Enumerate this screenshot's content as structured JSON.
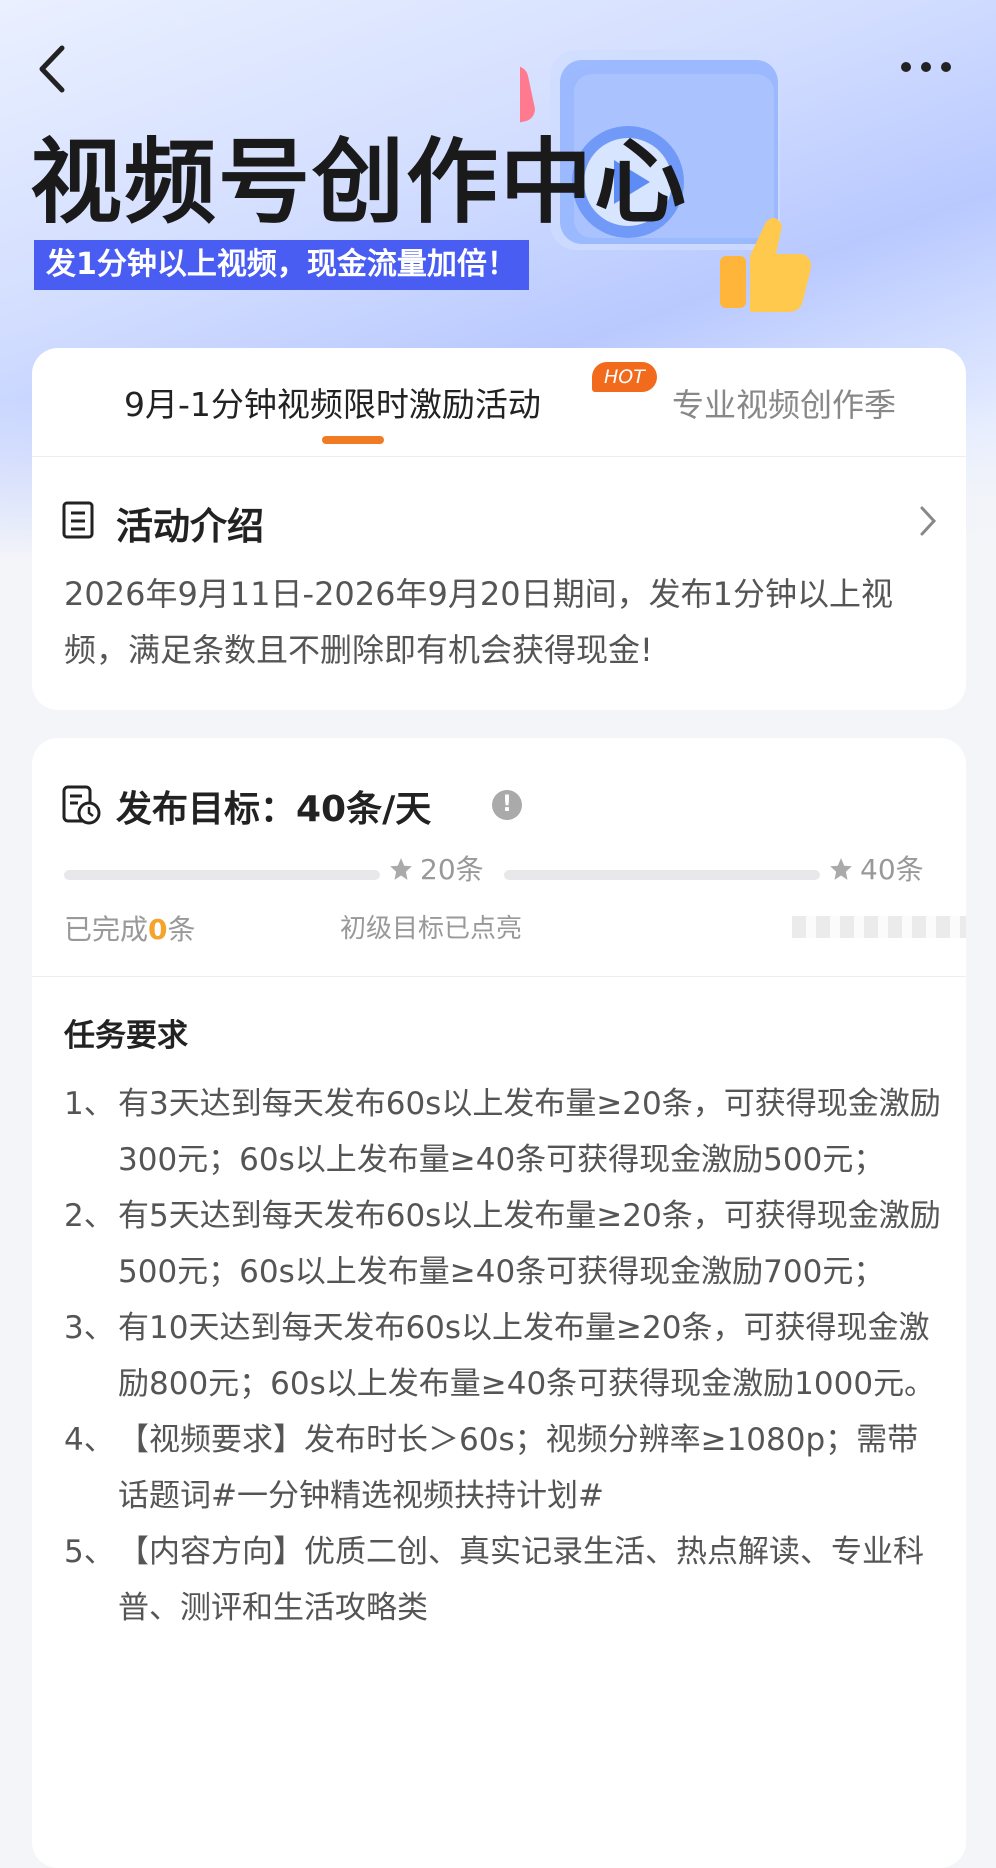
{
  "hero": {
    "title": "视频号创作中心",
    "subtitle": "发1分钟以上视频，现金流量加倍！"
  },
  "tabs": [
    {
      "label": "9月-1分钟视频限时激励活动",
      "badge": "HOT",
      "active": true
    },
    {
      "label": "专业视频创作季",
      "active": false
    }
  ],
  "intro": {
    "title": "活动介绍",
    "text": "2026年9月11日-2026年9月20日期间，发布1分钟以上视频，满足条数且不删除即有机会获得现金!"
  },
  "goal": {
    "title": "发布目标：40条/天",
    "progress_fraction": 0,
    "milestones": [
      {
        "label": "20条"
      },
      {
        "label": "40条"
      }
    ],
    "done_prefix": "已完成",
    "done_count": "0",
    "done_suffix": "条",
    "level_text": "初级目标已点亮"
  },
  "requirements": {
    "title": "任务要求",
    "items": [
      {
        "num": "1、",
        "text": "有3天达到每天发布60s以上发布量≥20条，可获得现金激励300元；60s以上发布量≥40条可获得现金激励500元；"
      },
      {
        "num": "2、",
        "text": "有5天达到每天发布60s以上发布量≥20条，可获得现金激励500元；60s以上发布量≥40条可获得现金激励700元；"
      },
      {
        "num": "3、",
        "text": "有10天达到每天发布60s以上发布量≥20条，可获得现金激励800元；60s以上发布量≥40条可获得现金激励1000元。"
      },
      {
        "num": "4、",
        "text": "【视频要求】发布时长＞60s；视频分辨率≥1080p；需带话题词#一分钟精选视频扶持计划#"
      },
      {
        "num": "5、",
        "text": "【内容方向】优质二创、真实记录生活、热点解读、专业科普、测评和生活攻略类"
      }
    ]
  },
  "colors": {
    "accent": "#f07b22",
    "hot": "#f26a1b",
    "subtitle_bg": "#4a5df2",
    "count": "#f5a32a"
  },
  "icons": [
    "back-arrow-icon",
    "more-dots-icon",
    "heart-icon",
    "play-icon",
    "thumbs-up-icon",
    "document-icon",
    "chevron-right-icon",
    "target-clock-icon",
    "info-icon",
    "star-icon"
  ]
}
